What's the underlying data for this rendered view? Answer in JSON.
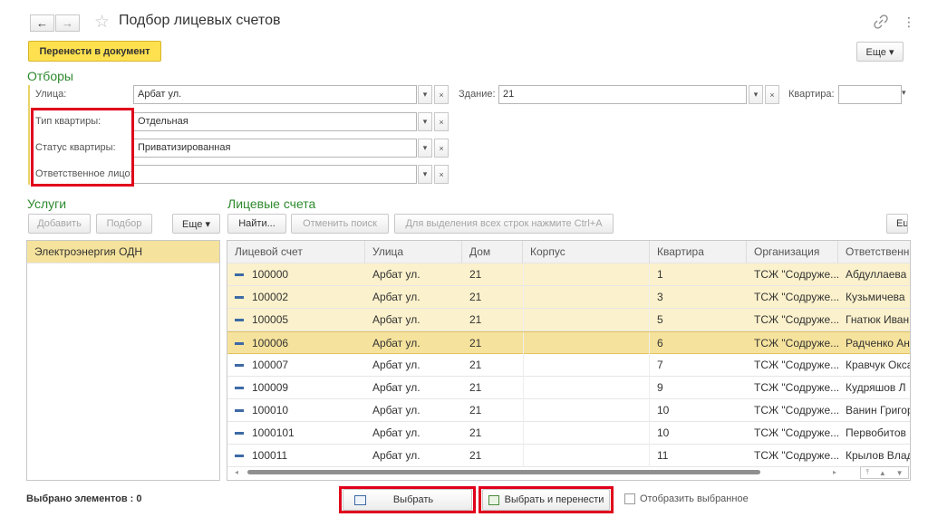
{
  "header": {
    "back_icon": "←",
    "forward_icon": "→",
    "star_icon": "☆",
    "title": "Подбор лицевых счетов",
    "link_icon": "🔗",
    "menu_icon": "⋮"
  },
  "toolbar": {
    "transfer_label": "Перенести в документ",
    "more_label": "Еще ▾"
  },
  "filters": {
    "section_title": "Отборы",
    "street_label": "Улица:",
    "street_value": "Арбат ул.",
    "building_label": "Здание:",
    "building_value": "21",
    "apartment_label": "Квартира:",
    "apartment_value": "",
    "apt_type_label": "Тип квартиры:",
    "apt_type_value": "Отдельная",
    "apt_status_label": "Статус квартиры:",
    "apt_status_value": "Приватизированная",
    "responsible_label": "Ответственное лицо:",
    "responsible_value": "",
    "dropdown_icon": "▾",
    "clear_icon": "×"
  },
  "services": {
    "section_title": "Услуги",
    "add_label": "Добавить",
    "pick_label": "Подбор",
    "more_label": "Еще ▾",
    "items": [
      "Электроэнергия ОДН"
    ]
  },
  "accounts": {
    "section_title": "Лицевые счета",
    "find_label": "Найти...",
    "cancel_search_label": "Отменить поиск",
    "select_all_hint": "Для выделения всех строк нажмите Ctrl+A",
    "more_label": "Ец",
    "columns": [
      "Лицевой счет",
      "Улица",
      "Дом",
      "Корпус",
      "Квартира",
      "Организация",
      "Ответственн"
    ],
    "rows": [
      [
        "100000",
        "Арбат ул.",
        "21",
        "",
        "1",
        "ТСЖ \"Содруже...",
        "Абдуллаева"
      ],
      [
        "100002",
        "Арбат ул.",
        "21",
        "",
        "3",
        "ТСЖ \"Содруже...",
        "Кузьмичева"
      ],
      [
        "100005",
        "Арбат ул.",
        "21",
        "",
        "5",
        "ТСЖ \"Содруже...",
        "Гнатюк Иван"
      ],
      [
        "100006",
        "Арбат ул.",
        "21",
        "",
        "6",
        "ТСЖ \"Содруже...",
        "Радченко Ан"
      ],
      [
        "100007",
        "Арбат ул.",
        "21",
        "",
        "7",
        "ТСЖ \"Содруже...",
        "Кравчук Окса"
      ],
      [
        "100009",
        "Арбат ул.",
        "21",
        "",
        "9",
        "ТСЖ \"Содруже...",
        "Кудряшов Л"
      ],
      [
        "100010",
        "Арбат ул.",
        "21",
        "",
        "10",
        "ТСЖ \"Содруже...",
        "Ванин Григор"
      ],
      [
        "1000101",
        "Арбат ул.",
        "21",
        "",
        "10",
        "ТСЖ \"Содруже...",
        "Первобитов Е"
      ],
      [
        "100011",
        "Арбат ул.",
        "21",
        "",
        "11",
        "ТСЖ \"Содруже...",
        "Крылов Влад"
      ]
    ],
    "selected_rows": [
      0,
      1,
      2
    ],
    "current_row": 3
  },
  "footer": {
    "selected_count_label": "Выбрано элементов : 0",
    "select_label": "Выбрать",
    "select_transfer_label": "Выбрать и перенести",
    "show_selected_label": "Отобразить выбранное"
  },
  "colors": {
    "accent_yellow": "#ffe14f",
    "section_green": "#2e8a2e",
    "highlight_red": "#e0001b",
    "selected_row": "#fbf1cc",
    "current_row": "#f5e29c"
  }
}
